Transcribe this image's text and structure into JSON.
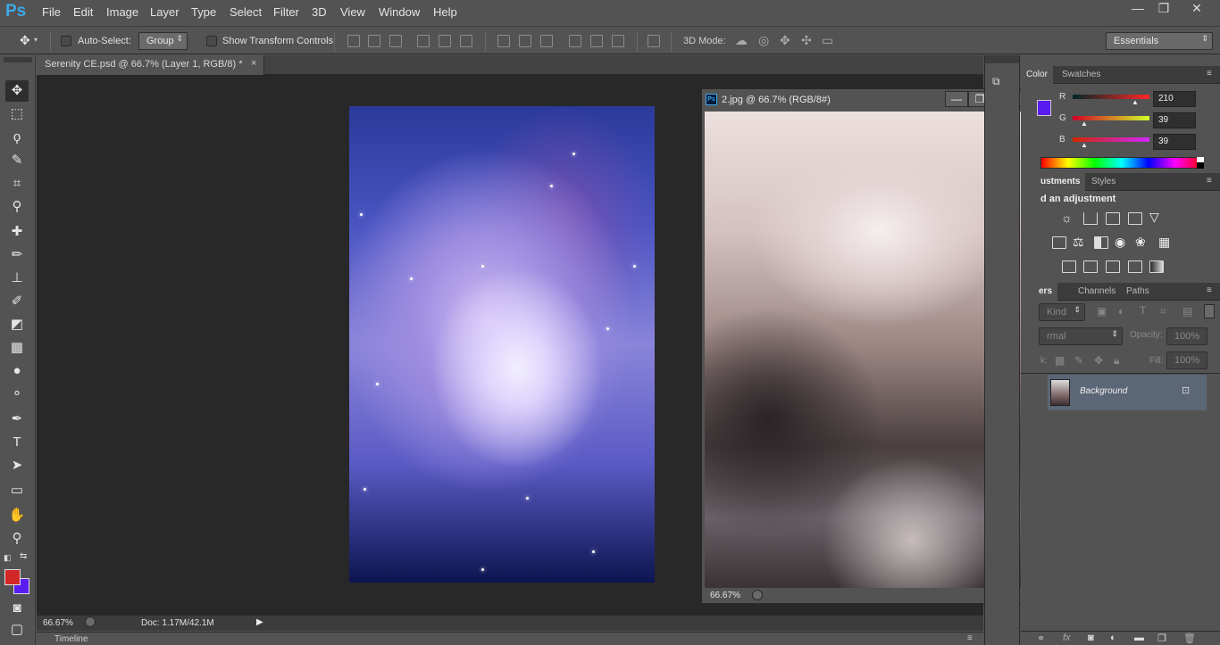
{
  "app": {
    "logo": "Ps"
  },
  "menu": [
    "File",
    "Edit",
    "Image",
    "Layer",
    "Type",
    "Select",
    "Filter",
    "3D",
    "View",
    "Window",
    "Help"
  ],
  "window_controls": {
    "minimize": "—",
    "restore": "❐",
    "close": "✕"
  },
  "options_bar": {
    "auto_select_label": "Auto-Select:",
    "auto_select_value": "Group",
    "show_transform_label": "Show Transform Controls",
    "mode_label": "3D Mode:",
    "workspace": "Essentials"
  },
  "document": {
    "tab_title": "Serenity CE.psd @ 66.7% (Layer 1, RGB/8) *",
    "tab_close": "×",
    "zoom": "66.67%",
    "doc_size": "Doc: 1.17M/42.1M",
    "timeline_label": "Timeline"
  },
  "floating_window": {
    "icon": "Ps",
    "title": "2.jpg @ 66.7% (RGB/8#)",
    "zoom": "66.67%"
  },
  "color_panel": {
    "tabs": [
      "Color",
      "Swatches"
    ],
    "channels": [
      {
        "label": "R",
        "value": "210"
      },
      {
        "label": "G",
        "value": "39"
      },
      {
        "label": "B",
        "value": "39"
      }
    ],
    "foreground": "#d22727",
    "background": "#5a1cf0"
  },
  "adjustments_panel": {
    "tabs": [
      "ustments",
      "Styles"
    ],
    "heading": "d an adjustment"
  },
  "layers_panel": {
    "tabs": [
      "ers",
      "Channels",
      "Paths"
    ],
    "filter_kind": "Kind",
    "blend_mode": "rmal",
    "opacity_label": "Opacity:",
    "opacity_value": "100%",
    "lock_label": "k:",
    "fill_label": "Fill:",
    "fill_value": "100%",
    "layers": [
      {
        "name": "Background"
      }
    ]
  },
  "footer_icons": [
    "link-icon",
    "fx-icon",
    "mask-icon",
    "adjustment-icon",
    "folder-icon",
    "new-layer-icon",
    "trash-icon"
  ]
}
